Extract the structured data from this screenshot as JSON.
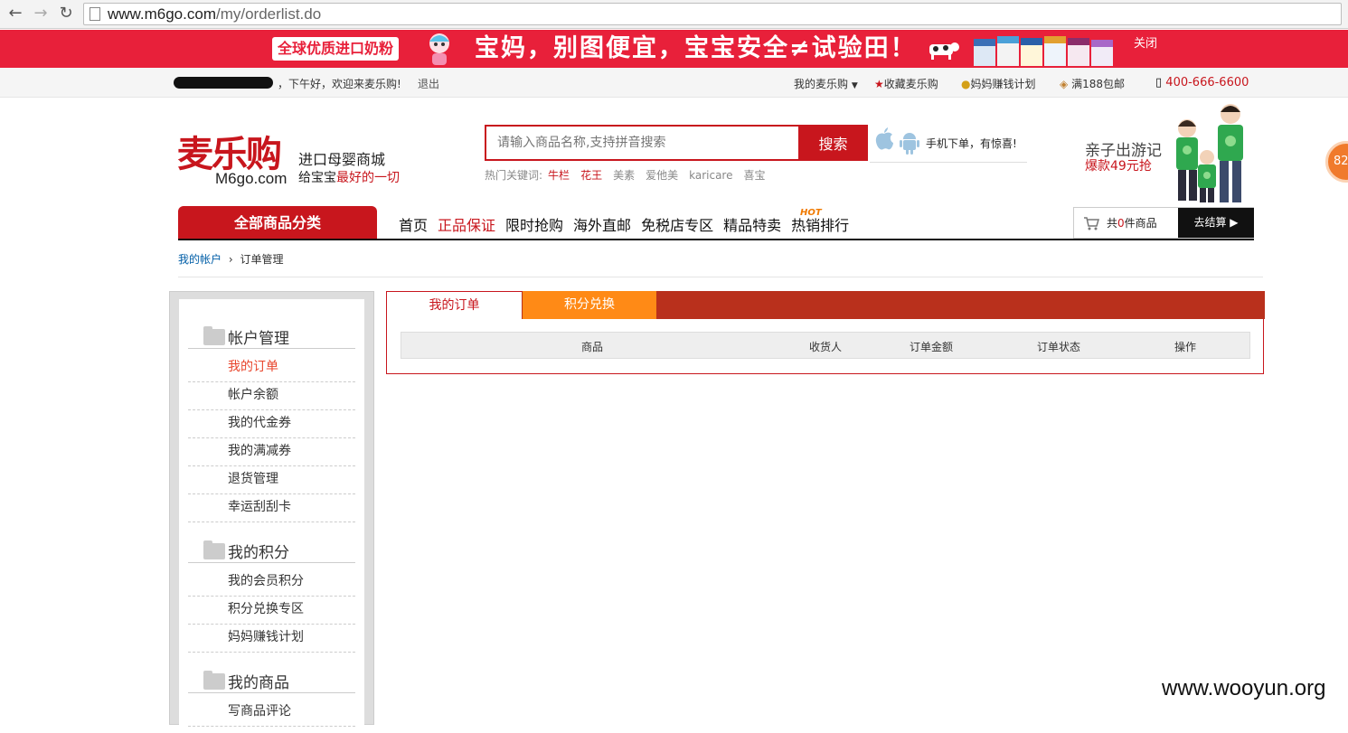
{
  "browser": {
    "url_host": "www.m6go.com",
    "url_path": "/my/orderlist.do"
  },
  "banner": {
    "tag": "全球优质进口奶粉",
    "slogan": "宝妈，别图便宜，宝宝安全≠试验田！",
    "close": "关闭"
  },
  "topbar": {
    "greeting": "，下午好，欢迎来麦乐购!",
    "logout": "退出",
    "my_account": "我的麦乐购",
    "favorite": "收藏麦乐购",
    "earn_plan": "妈妈赚钱计划",
    "free_ship": "满188包邮",
    "phone": "400-666-6600"
  },
  "header": {
    "logo": "麦乐购",
    "logo_sub": "M6go.com",
    "tagline1": "进口母婴商城",
    "tagline2_prefix": "给宝宝",
    "tagline2_highlight": "最好的一切",
    "search_placeholder": "请输入商品名称,支持拼音搜索",
    "search_button": "搜索",
    "hot_label": "热门关键词:",
    "hot_keywords": [
      "牛栏",
      "花王",
      "美素",
      "爱他美",
      "karicare",
      "喜宝"
    ],
    "mobile_text": "手机下单，有惊喜!",
    "promo_title": "亲子出游记",
    "promo_sub": "爆款49元抢",
    "bubble": "82"
  },
  "nav": {
    "all_categories": "全部商品分类",
    "items": [
      "首页",
      "正品保证",
      "限时抢购",
      "海外直邮",
      "免税店专区",
      "精品特卖",
      "热销排行"
    ],
    "hot_badge": "HOT",
    "cart_prefix": "共",
    "cart_count": "0",
    "cart_suffix": "件商品",
    "checkout": "去结算"
  },
  "breadcrumb": {
    "root": "我的帐户",
    "sep": "›",
    "current": "订单管理"
  },
  "sidebar": {
    "sections": [
      {
        "title": "帐户管理",
        "items": [
          "我的订单",
          "帐户余额",
          "我的代金券",
          "我的满减券",
          "退货管理",
          "幸运刮刮卡"
        ]
      },
      {
        "title": "我的积分",
        "items": [
          "我的会员积分",
          "积分兑换专区",
          "妈妈赚钱计划"
        ]
      },
      {
        "title": "我的商品",
        "items": [
          "写商品评论"
        ]
      }
    ]
  },
  "orders": {
    "tabs": [
      "我的订单",
      "积分兑换"
    ],
    "columns": [
      "商品",
      "收货人",
      "订单金额",
      "订单状态",
      "操作"
    ]
  },
  "watermark": "www.wooyun.org",
  "colors": {
    "brand_red": "#c8161d",
    "tab_orange": "#ff8a16",
    "banner_red": "#e8203a"
  }
}
